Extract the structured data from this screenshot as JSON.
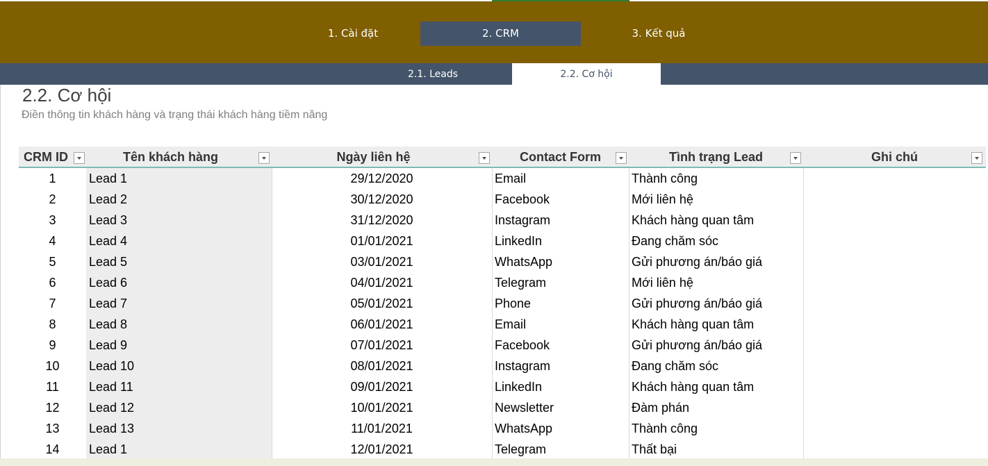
{
  "main_nav": {
    "tabs": [
      {
        "label": "1. Cài đặt",
        "active": false
      },
      {
        "label": "2. CRM",
        "active": true
      },
      {
        "label": "3. Kết quả",
        "active": false
      }
    ]
  },
  "sub_nav": {
    "tabs": [
      {
        "label": "2.1. Leads",
        "active": false
      },
      {
        "label": "2.2. Cơ hội",
        "active": true
      }
    ]
  },
  "page": {
    "title": "2.2. Cơ hội",
    "subtitle": "Điền thông tin khách hàng và trạng thái khách hàng tiềm năng"
  },
  "table": {
    "columns": [
      "CRM ID",
      "Tên khách hàng",
      "Ngày liên hệ",
      "Contact Form",
      "Tình trạng Lead",
      "Ghi chú"
    ],
    "rows": [
      {
        "id": "1",
        "name": "Lead 1",
        "date": "29/12/2020",
        "form": "Email",
        "status": "Thành công",
        "note": ""
      },
      {
        "id": "2",
        "name": "Lead 2",
        "date": "30/12/2020",
        "form": "Facebook",
        "status": "Mới liên hệ",
        "note": ""
      },
      {
        "id": "3",
        "name": "Lead 3",
        "date": "31/12/2020",
        "form": "Instagram",
        "status": "Khách hàng quan tâm",
        "note": ""
      },
      {
        "id": "4",
        "name": "Lead 4",
        "date": "01/01/2021",
        "form": "LinkedIn",
        "status": "Đang chăm sóc",
        "note": ""
      },
      {
        "id": "5",
        "name": "Lead 5",
        "date": "03/01/2021",
        "form": "WhatsApp",
        "status": "Gửi phương án/báo giá",
        "note": ""
      },
      {
        "id": "6",
        "name": "Lead 6",
        "date": "04/01/2021",
        "form": "Telegram",
        "status": "Mới liên hệ",
        "note": ""
      },
      {
        "id": "7",
        "name": "Lead 7",
        "date": "05/01/2021",
        "form": "Phone",
        "status": "Gửi phương án/báo giá",
        "note": ""
      },
      {
        "id": "8",
        "name": "Lead 8",
        "date": "06/01/2021",
        "form": "Email",
        "status": "Khách hàng quan tâm",
        "note": ""
      },
      {
        "id": "9",
        "name": "Lead 9",
        "date": "07/01/2021",
        "form": "Facebook",
        "status": "Gửi phương án/báo giá",
        "note": ""
      },
      {
        "id": "10",
        "name": "Lead 10",
        "date": "08/01/2021",
        "form": "Instagram",
        "status": "Đang chăm sóc",
        "note": ""
      },
      {
        "id": "11",
        "name": "Lead 11",
        "date": "09/01/2021",
        "form": "LinkedIn",
        "status": "Khách hàng quan tâm",
        "note": ""
      },
      {
        "id": "12",
        "name": "Lead 12",
        "date": "10/01/2021",
        "form": "Newsletter",
        "status": "Đàm phán",
        "note": ""
      },
      {
        "id": "13",
        "name": "Lead 13",
        "date": "11/01/2021",
        "form": "WhatsApp",
        "status": "Thành công",
        "note": ""
      },
      {
        "id": "14",
        "name": "Lead 1",
        "date": "12/01/2021",
        "form": "Telegram",
        "status": "Thất bại",
        "note": ""
      }
    ]
  },
  "colors": {
    "main_nav_bg": "#7f5f00",
    "active_tab_bg": "#44546a",
    "header_bg": "#ededed",
    "header_rule": "#7cbcb3"
  }
}
